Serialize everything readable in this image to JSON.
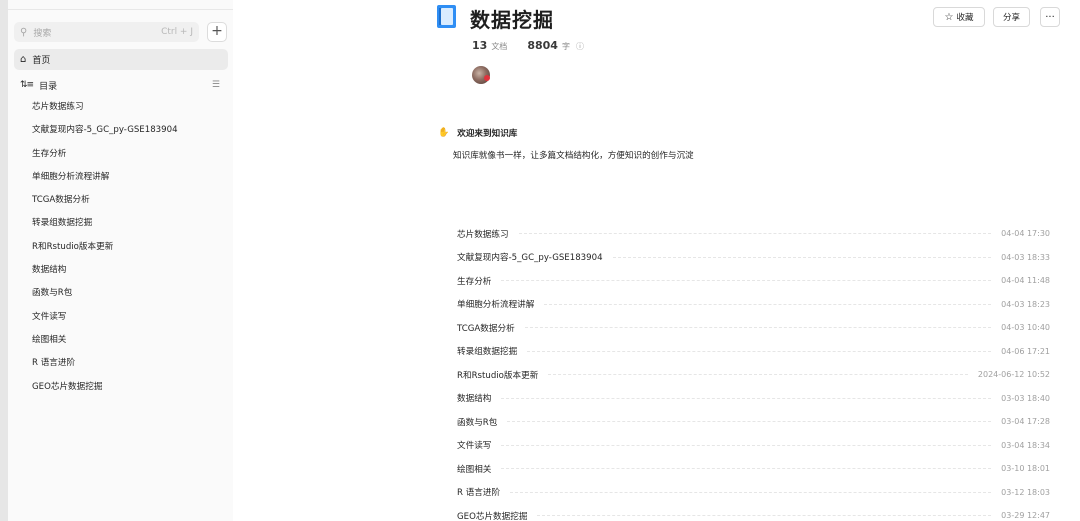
{
  "sidebar": {
    "search_placeholder": "搜索",
    "search_shortcut": "Ctrl + J",
    "add_label": "+",
    "home_label": "首页",
    "toc_label": "目录",
    "items": [
      "芯片数据练习",
      "文献复现内容-5_GC_py-GSE183904",
      "生存分析",
      "单细胞分析流程讲解",
      "TCGA数据分析",
      "转录组数据挖掘",
      "R和Rstudio版本更新",
      "数据结构",
      "函数与R包",
      "文件读写",
      "绘图相关",
      "R 语言进阶",
      "GEO芯片数据挖掘"
    ]
  },
  "header": {
    "title": "数据挖掘",
    "doc_count": "13",
    "doc_unit": "文档",
    "word_count": "8804",
    "word_unit": "字",
    "star_label": "收藏",
    "share_label": "分享",
    "more_label": "···"
  },
  "welcome": {
    "title": "欢迎来到知识库",
    "description": "知识库就像书一样，让多篇文档结构化，方便知识的创作与沉淀"
  },
  "documents": [
    {
      "title": "芯片数据练习",
      "date": "04-04 17:30"
    },
    {
      "title": "文献复现内容-5_GC_py-GSE183904",
      "date": "04-03 18:33"
    },
    {
      "title": "生存分析",
      "date": "04-04 11:48"
    },
    {
      "title": "单细胞分析流程讲解",
      "date": "04-03 18:23"
    },
    {
      "title": "TCGA数据分析",
      "date": "04-03 10:40"
    },
    {
      "title": "转录组数据挖掘",
      "date": "04-06 17:21"
    },
    {
      "title": "R和Rstudio版本更新",
      "date": "2024-06-12 10:52"
    },
    {
      "title": "数据结构",
      "date": "03-03 18:40"
    },
    {
      "title": "函数与R包",
      "date": "03-04 17:28"
    },
    {
      "title": "文件读写",
      "date": "03-04 18:34"
    },
    {
      "title": "绘图相关",
      "date": "03-10 18:01"
    },
    {
      "title": "R 语言进阶",
      "date": "03-12 18:03"
    },
    {
      "title": "GEO芯片数据挖掘",
      "date": "03-29 12:47"
    }
  ],
  "icons": {
    "search": "search-icon",
    "home": "home-icon",
    "toc": "toc-icon",
    "book": "book-icon",
    "star": "star-icon",
    "info": "info-icon",
    "hand": "waving-hand-icon"
  },
  "colors": {
    "accent": "#2f8ef4",
    "sidebar_bg": "#fafafa",
    "active_item_bg": "#ebebeb"
  }
}
